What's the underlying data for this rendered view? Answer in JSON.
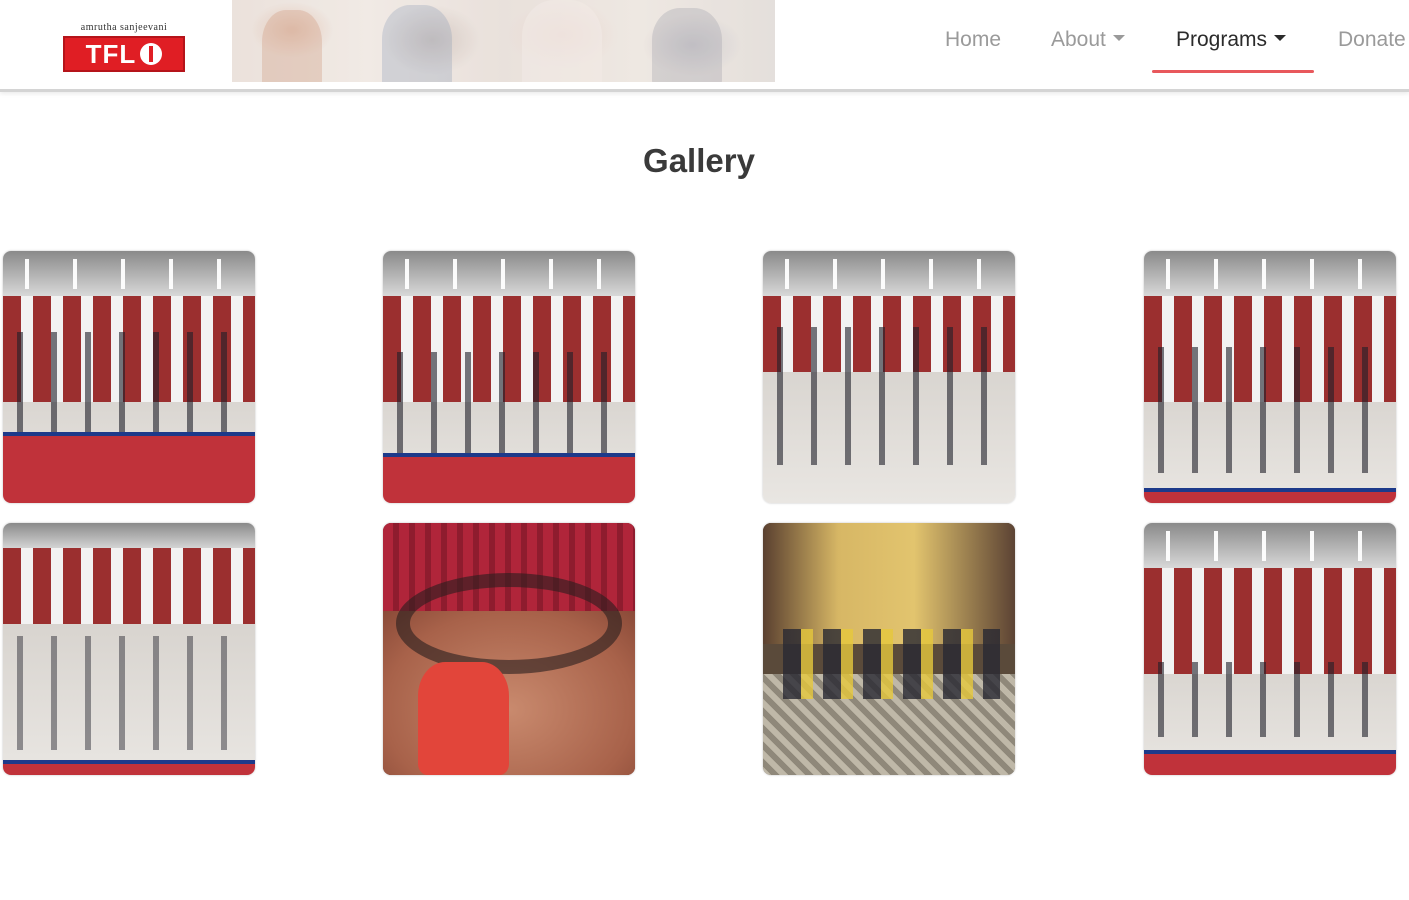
{
  "brand": {
    "tagline": "amrutha sanjeevani",
    "name": "TFL",
    "accent_color": "#e01e24"
  },
  "nav": {
    "items": [
      {
        "label": "Home",
        "has_dropdown": false,
        "active": false
      },
      {
        "label": "About",
        "has_dropdown": true,
        "active": false
      },
      {
        "label": "Programs",
        "has_dropdown": true,
        "active": true
      },
      {
        "label": "Donate",
        "has_dropdown": false,
        "active": false
      }
    ],
    "active_underline_color": "#e8585c"
  },
  "page": {
    "title": "Gallery"
  },
  "gallery": {
    "photos": [
      {
        "scene": "hall-standing-group"
      },
      {
        "scene": "hall-standing-group"
      },
      {
        "scene": "hall-dancing-group"
      },
      {
        "scene": "hall-standing-group"
      },
      {
        "scene": "hall-seated-group"
      },
      {
        "scene": "circle-holding-hands"
      },
      {
        "scene": "seated-circle-meeting"
      },
      {
        "scene": "hall-seated-group"
      }
    ]
  }
}
